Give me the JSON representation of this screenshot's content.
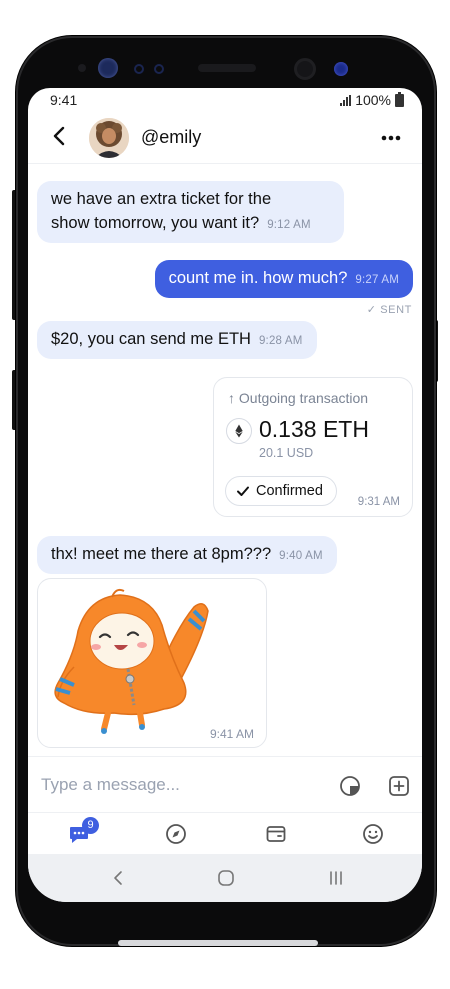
{
  "status_bar": {
    "time": "9:41",
    "battery": "100%"
  },
  "header": {
    "username": "@emily"
  },
  "messages": [
    {
      "direction": "in",
      "line1": "we have an extra ticket for the",
      "line2": "show tomorrow, you want it?",
      "time": "9:12 AM"
    },
    {
      "direction": "out",
      "text": "count me in. how much?",
      "time": "9:27 AM",
      "status": "SENT"
    },
    {
      "direction": "in",
      "text": "$20, you can send me ETH",
      "time": "9:28 AM"
    },
    {
      "direction": "in",
      "text": "thx! meet me there at 8pm???",
      "time": "9:40 AM"
    }
  ],
  "transaction": {
    "title": "Outgoing transaction",
    "amount": "0.138 ETH",
    "usd": "20.1 USD",
    "status": "Confirmed",
    "time": "9:31 AM"
  },
  "sticker": {
    "time": "9:41 AM"
  },
  "composer": {
    "placeholder": "Type a message..."
  },
  "tabs": [
    {
      "name": "chat",
      "icon": "chat-icon",
      "badge": "9"
    },
    {
      "name": "explore",
      "icon": "compass-icon"
    },
    {
      "name": "wallet",
      "icon": "wallet-icon"
    },
    {
      "name": "profile",
      "icon": "smiley-icon"
    }
  ],
  "colors": {
    "accent": "#3f5fe0",
    "incoming_bubble": "#e8eefc",
    "sticker_orange": "#f7882a"
  }
}
